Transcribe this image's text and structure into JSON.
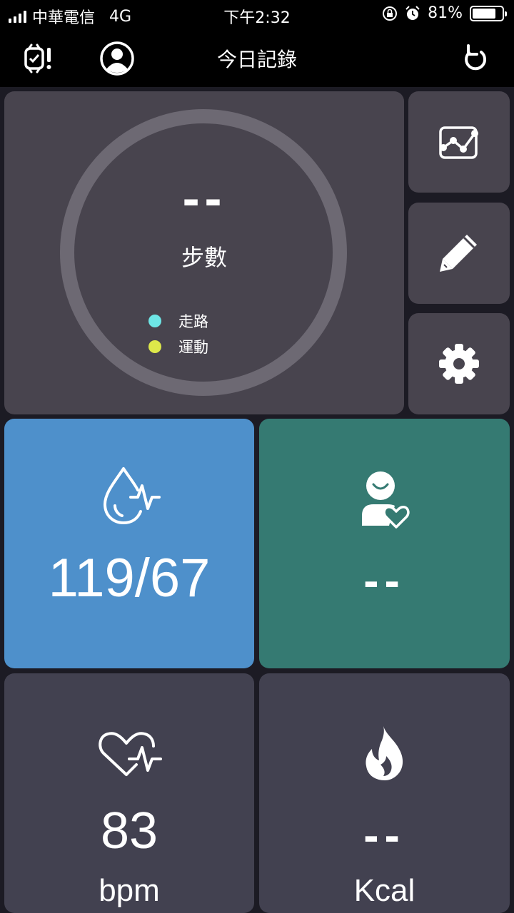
{
  "status": {
    "carrier": "中華電信",
    "network": "4G",
    "time": "下午2:32",
    "battery_percent": "81%",
    "battery_level": 0.81
  },
  "nav": {
    "title": "今日記錄",
    "left_icons": [
      "watch-alert-icon",
      "profile-icon"
    ],
    "right_icon": "refresh-icon"
  },
  "steps": {
    "value": "--",
    "label": "步數",
    "legend": [
      {
        "label": "走路",
        "color": "#6ee6e6"
      },
      {
        "label": "運動",
        "color": "#dde84a"
      }
    ]
  },
  "side_buttons": [
    "chart-icon",
    "edit-icon",
    "settings-icon"
  ],
  "tiles": {
    "blood_pressure": {
      "value": "119/67",
      "icon": "blood-pressure-icon",
      "color": "#4e90cb"
    },
    "mood": {
      "value": "--",
      "icon": "person-heart-icon",
      "color": "#357a72"
    },
    "heart_rate": {
      "value": "83",
      "unit": "bpm",
      "icon": "heart-rate-icon"
    },
    "calories": {
      "value": "--",
      "unit": "Kcal",
      "icon": "flame-icon"
    }
  }
}
